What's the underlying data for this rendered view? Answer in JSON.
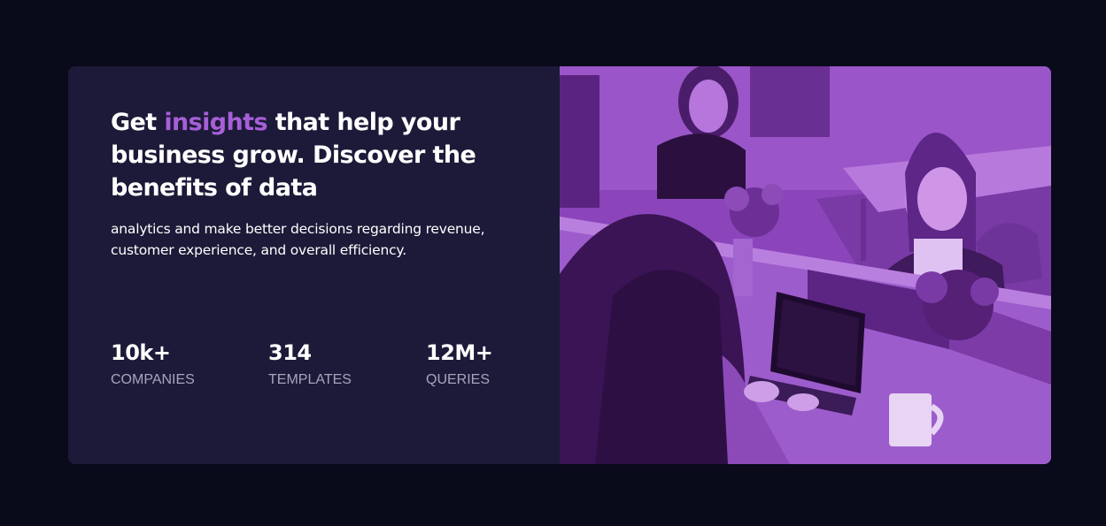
{
  "card": {
    "headline": {
      "before": "Get ",
      "accent": "insights",
      "after": " that help your business grow. Discover the benefits of data"
    },
    "subtext": "analytics and make better decisions regarding revenue, customer experience, and overall efficiency.",
    "stats": [
      {
        "value": "10k+",
        "label": "COMPANIES"
      },
      {
        "value": "314",
        "label": "TEMPLATES"
      },
      {
        "value": "12M+",
        "label": "QUERIES"
      }
    ]
  },
  "colors": {
    "page_background": "#090a1a",
    "card_background": "#1c1a38",
    "accent": "#a75fd8",
    "photo_overlay": "#8a42b8",
    "stat_label": "#a8a4bc"
  },
  "image": {
    "description_icon": "office-photo"
  }
}
